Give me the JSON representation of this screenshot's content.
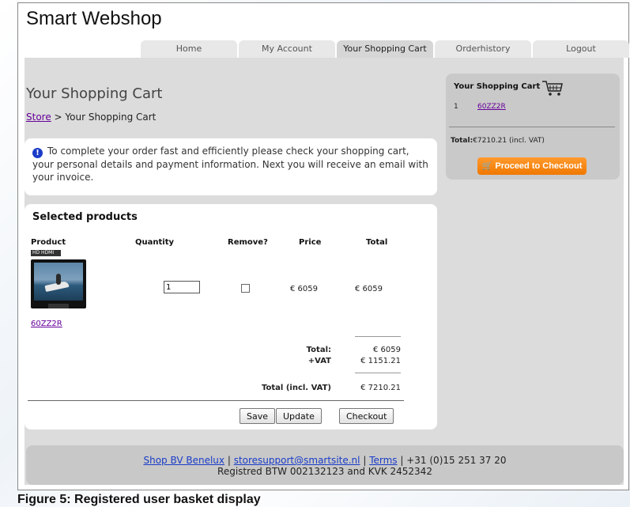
{
  "site": {
    "title": "Smart Webshop"
  },
  "tabs": [
    {
      "label": "Home"
    },
    {
      "label": "My Account"
    },
    {
      "label": "Your Shopping Cart"
    },
    {
      "label": "Orderhistory"
    },
    {
      "label": "Logout"
    }
  ],
  "page": {
    "title": "Your Shopping Cart",
    "breadcrumb_link": "Store",
    "breadcrumb_rest": " > Your Shopping Cart",
    "info_text": "To complete your order fast and efficiently please check your shopping cart, your personal details and payment information. Next you will receive an email with your invoice."
  },
  "products": {
    "title": "Selected products",
    "headers": {
      "product": "Product",
      "quantity": "Quantity",
      "remove": "Remove?",
      "price": "Price",
      "total": "Total"
    },
    "hd_badge": "HD HDMI",
    "items": [
      {
        "name": "60ZZ2R",
        "quantity": "1",
        "price": "€ 6059",
        "total": "€ 6059"
      }
    ],
    "total_label": "Total:",
    "total_value": "€ 6059",
    "vat_label": "+VAT",
    "vat_value": "€ 1151.21",
    "grand_label": "Total (incl. VAT)",
    "grand_value": "€ 7210.21",
    "buttons": {
      "save": "Save",
      "update": "Update",
      "checkout": "Checkout"
    }
  },
  "sidebar": {
    "title": "Your Shopping Cart",
    "item_num": "1",
    "item_name": "60ZZ2R",
    "total_label": "Total:",
    "total_value": "€7210.21 (incl. VAT)",
    "checkout_label": "Proceed to Checkout"
  },
  "footer": {
    "link1": "Shop BV Benelux",
    "link2": "storesupport@smartsite.nl",
    "link3": "Terms",
    "phone": "| +31 (0)15 251 37 20",
    "line2": "Registred BTW 002132123 and KVK 2452342"
  },
  "caption": "Figure 5: Registered user basket display"
}
